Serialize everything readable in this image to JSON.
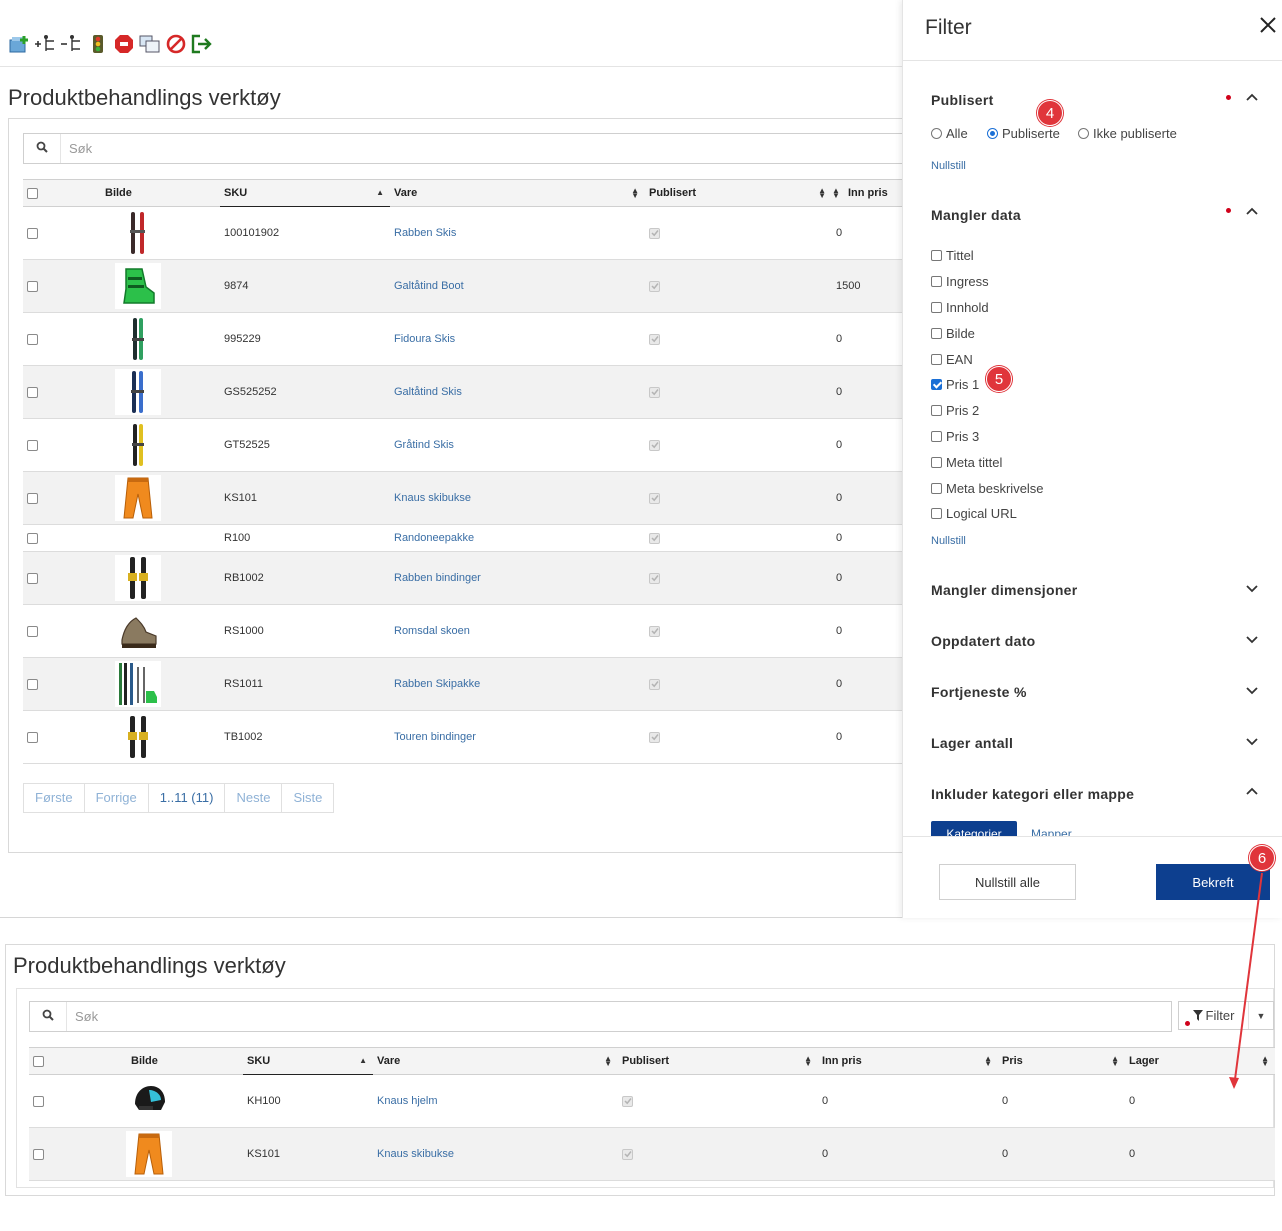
{
  "top": {
    "toolbar_icons": [
      "add-product-icon",
      "add-node-icon",
      "remove-node-icon",
      "traffic-light-icon",
      "stop-icon",
      "copy-icon",
      "block-icon",
      "exit-icon"
    ],
    "title": "Produktbehandlings verktøy",
    "search": {
      "placeholder": "Søk"
    },
    "columns": [
      "Bilde",
      "SKU",
      "Vare",
      "Publisert",
      "Inn pris"
    ],
    "rows": [
      {
        "sku": "100101902",
        "name": "Rabben Skis",
        "inn_pris": "0",
        "image": "ski-red-icon"
      },
      {
        "sku": "9874",
        "name": "Galtåtind Boot",
        "inn_pris": "1500",
        "image": "boot-green-icon"
      },
      {
        "sku": "995229",
        "name": "Fidoura Skis",
        "inn_pris": "0",
        "image": "ski-green-icon"
      },
      {
        "sku": "GS525252",
        "name": "Galtåtind Skis",
        "inn_pris": "0",
        "image": "ski-blue-icon"
      },
      {
        "sku": "GT52525",
        "name": "Gråtind Skis",
        "inn_pris": "0",
        "image": "ski-yellow-icon"
      },
      {
        "sku": "KS101",
        "name": "Knaus skibukse",
        "inn_pris": "0",
        "image": "pants-orange-icon"
      },
      {
        "sku": "R100",
        "name": "Randoneepakke",
        "inn_pris": "0",
        "image": ""
      },
      {
        "sku": "RB1002",
        "name": "Rabben bindinger",
        "inn_pris": "0",
        "image": "binding-icon"
      },
      {
        "sku": "RS1000",
        "name": "Romsdal skoen",
        "inn_pris": "0",
        "image": "shoe-brown-icon"
      },
      {
        "sku": "RS1011",
        "name": "Rabben Skipakke",
        "inn_pris": "0",
        "image": "ski-package-icon"
      },
      {
        "sku": "TB1002",
        "name": "Touren bindinger",
        "inn_pris": "0",
        "image": "binding-icon"
      }
    ],
    "pager": [
      "Første",
      "Forrige",
      "1..11 (11)",
      "Neste",
      "Siste"
    ]
  },
  "filter": {
    "title": "Filter",
    "close_label": "✕",
    "publisert": {
      "title": "Publisert",
      "options": [
        "Alle",
        "Publiserte",
        "Ikke publiserte"
      ],
      "selected": "Publiserte",
      "reset": "Nullstill"
    },
    "mangler_data": {
      "title": "Mangler data",
      "options": [
        "Tittel",
        "Ingress",
        "Innhold",
        "Bilde",
        "EAN",
        "Pris 1",
        "Pris 2",
        "Pris 3",
        "Meta tittel",
        "Meta beskrivelse",
        "Logical URL"
      ],
      "checked": [
        "Pris 1"
      ],
      "reset": "Nullstill"
    },
    "collapsed_sections": [
      "Mangler dimensjoner",
      "Oppdatert dato",
      "Fortjeneste %",
      "Lager antall"
    ],
    "inkluder": {
      "title": "Inkluder kategori eller mappe",
      "tabs": [
        "Kategorier",
        "Mapper"
      ]
    },
    "reset_all": "Nullstill alle",
    "confirm": "Bekreft"
  },
  "callouts": [
    "4",
    "5",
    "6"
  ],
  "bottom": {
    "title": "Produktbehandlings verktøy",
    "search": {
      "placeholder": "Søk"
    },
    "filter_button": "Filter",
    "columns": [
      "Bilde",
      "SKU",
      "Vare",
      "Publisert",
      "Inn pris",
      "Pris",
      "Lager"
    ],
    "rows": [
      {
        "sku": "KH100",
        "name": "Knaus hjelm",
        "inn_pris": "0",
        "pris": "0",
        "lager": "0",
        "image": "helmet-icon"
      },
      {
        "sku": "KS101",
        "name": "Knaus skibukse",
        "inn_pris": "0",
        "pris": "0",
        "lager": "0",
        "image": "pants-orange-icon"
      }
    ]
  },
  "colors": {
    "accent": "#0d3f8f",
    "link": "#3a6ea5",
    "callout": "#e0353b",
    "checkbox": "#1a6fd6"
  }
}
